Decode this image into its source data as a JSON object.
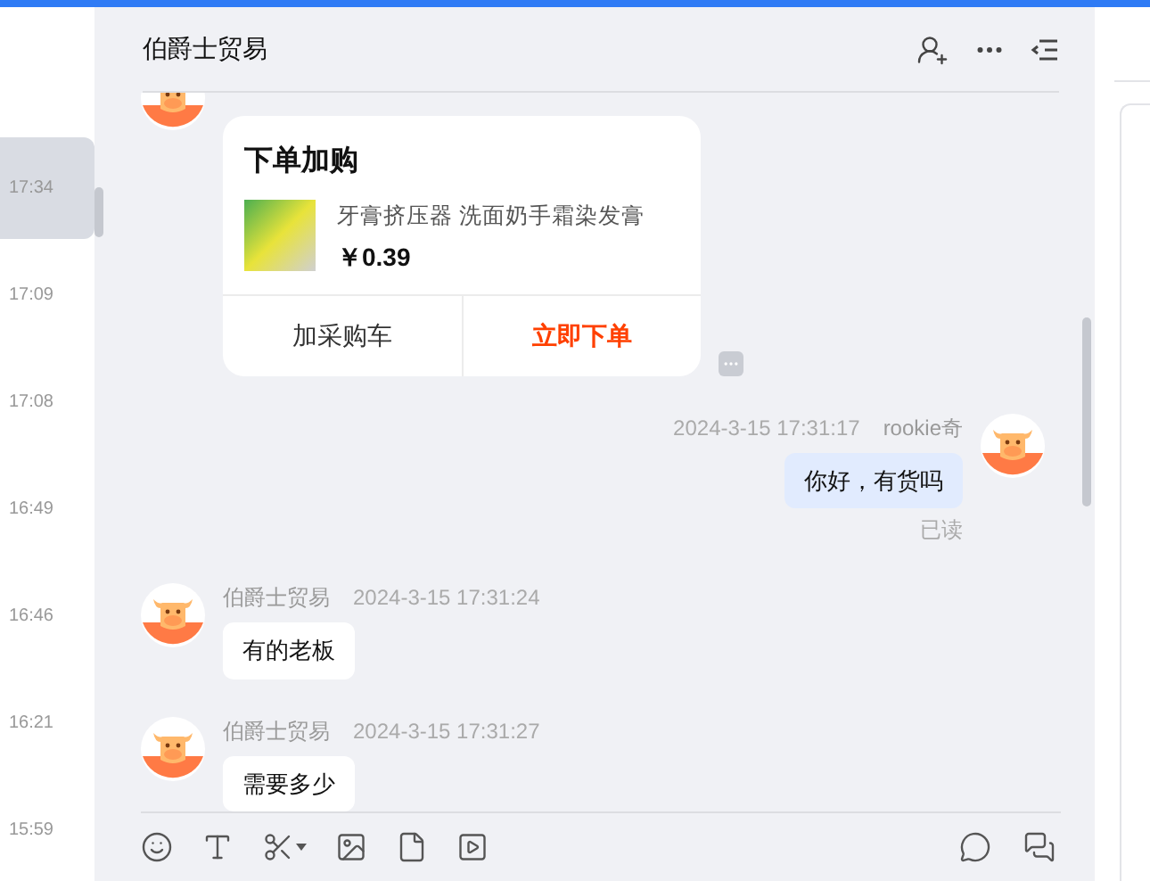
{
  "conversations": [
    {
      "time": "17:34",
      "selected": true
    },
    {
      "time": "17:09",
      "selected": false
    },
    {
      "time": "17:08",
      "selected": false
    },
    {
      "time": "16:49",
      "selected": false
    },
    {
      "time": "16:46",
      "selected": false
    },
    {
      "time": "16:21",
      "selected": false
    },
    {
      "time": "15:59",
      "selected": false
    }
  ],
  "chat": {
    "title": "伯爵士贸易"
  },
  "messages": [
    {
      "kind": "product_card",
      "title": "下单加购",
      "product_name": "牙膏挤压器 洗面奶手霜染发膏",
      "price": "￥0.39",
      "actions": [
        {
          "label": "加采购车",
          "kind": "secondary"
        },
        {
          "label": "立即下单",
          "kind": "primary"
        }
      ]
    },
    {
      "kind": "text",
      "outgoing": true,
      "sender": "rookie奇",
      "time": "2024-3-15 17:31:17",
      "text": "你好，有货吗",
      "status": "已读"
    },
    {
      "kind": "text",
      "outgoing": false,
      "sender": "伯爵士贸易",
      "time": "2024-3-15 17:31:24",
      "text": "有的老板"
    },
    {
      "kind": "text",
      "outgoing": false,
      "sender": "伯爵士贸易",
      "time": "2024-3-15 17:31:27",
      "text": "需要多少"
    }
  ]
}
